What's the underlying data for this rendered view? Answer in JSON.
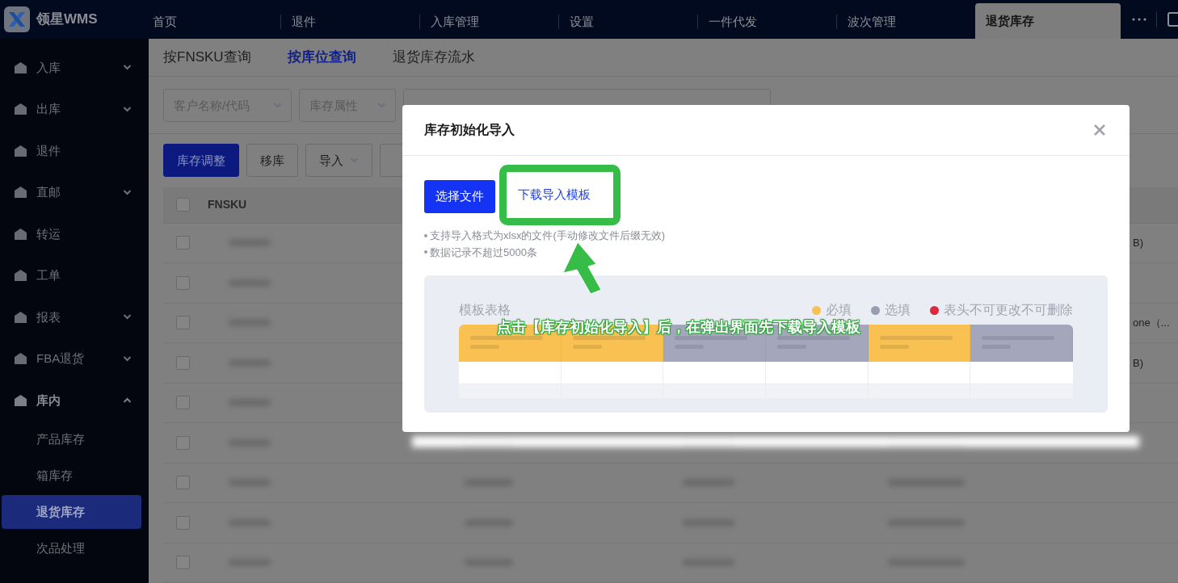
{
  "app": {
    "logo_text": "领星WMS"
  },
  "top_tabs": [
    {
      "label": "首页",
      "selected": false
    },
    {
      "label": "退件",
      "selected": false
    },
    {
      "label": "入库管理",
      "selected": false
    },
    {
      "label": "设置",
      "selected": false
    },
    {
      "label": "一件代发",
      "selected": false
    },
    {
      "label": "波次管理",
      "selected": false
    },
    {
      "label": "退货库存",
      "selected": true
    }
  ],
  "sidebar": {
    "items": [
      {
        "label": "入库",
        "kind": "group",
        "expanded": false
      },
      {
        "label": "出库",
        "kind": "group",
        "expanded": false
      },
      {
        "label": "退件",
        "kind": "link",
        "expanded": false
      },
      {
        "label": "直邮",
        "kind": "group",
        "expanded": false
      },
      {
        "label": "转运",
        "kind": "link",
        "expanded": false
      },
      {
        "label": "工单",
        "kind": "link",
        "expanded": false
      },
      {
        "label": "报表",
        "kind": "group",
        "expanded": false
      },
      {
        "label": "FBA退货",
        "kind": "group",
        "expanded": false
      },
      {
        "label": "库内",
        "kind": "group",
        "expanded": true,
        "children": [
          {
            "label": "产品库存",
            "selected": false
          },
          {
            "label": "箱库存",
            "selected": false
          },
          {
            "label": "退货库存",
            "selected": true
          },
          {
            "label": "次品处理",
            "selected": false
          }
        ]
      }
    ]
  },
  "sub_tabs": [
    {
      "label": "按FNSKU查询",
      "selected": false
    },
    {
      "label": "按库位查询",
      "selected": true
    },
    {
      "label": "退货库存流水",
      "selected": false
    }
  ],
  "filters": [
    {
      "placeholder": "客户名称/代码"
    },
    {
      "placeholder": "库存属性"
    }
  ],
  "toolbar": [
    {
      "label": "库存调整",
      "kind": "primary"
    },
    {
      "label": "移库",
      "kind": "plain"
    },
    {
      "label": "导入",
      "kind": "dropdown"
    }
  ],
  "table": {
    "columns": [
      "FNSKU"
    ],
    "header_checked": false,
    "rows": [
      {
        "checked": false,
        "column_5": "B)"
      },
      {
        "checked": false
      },
      {
        "checked": false,
        "column_5": "one（..."
      },
      {
        "checked": false,
        "column_5": "B)"
      },
      {
        "checked": false
      },
      {
        "checked": false
      },
      {
        "checked": false
      },
      {
        "checked": false
      },
      {
        "checked": false
      }
    ]
  },
  "modal": {
    "title": "库存初始化导入",
    "select_button": "选择文件",
    "download_link": "下载导入模板",
    "notes": [
      "支持导入格式为xlsx的文件(手动修改文件后缀无效)",
      "数据记录不超过5000条"
    ],
    "template": {
      "title": "模板表格",
      "legend": [
        {
          "label": "必填",
          "color": "#f9c152"
        },
        {
          "label": "选填",
          "color": "#9b9db0"
        },
        {
          "label": "表头不可更改不可删除",
          "color": "#e0283c"
        }
      ],
      "columns": [
        {
          "color": "#f9c152"
        },
        {
          "color": "#f9c152"
        },
        {
          "color": "#a4a7bc"
        },
        {
          "color": "#a4a7bc"
        },
        {
          "color": "#f9c152"
        },
        {
          "color": "#a4a7bc"
        }
      ]
    }
  },
  "annotation": {
    "text": "点击【库存初始化导入】后，在弹出界面先下载导入模板"
  }
}
